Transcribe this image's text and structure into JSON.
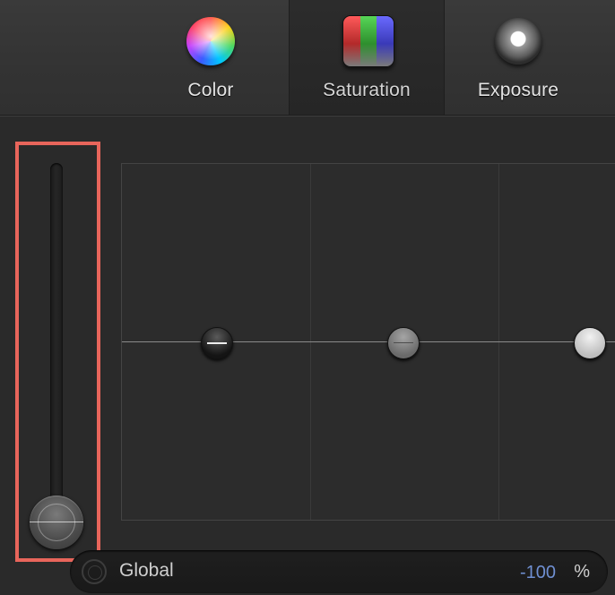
{
  "tabs": [
    {
      "label": "Color",
      "icon": "color-wheel-icon"
    },
    {
      "label": "Saturation",
      "icon": "saturation-bars-icon",
      "selected": true
    },
    {
      "label": "Exposure",
      "icon": "exposure-icon"
    }
  ],
  "global_slider": {
    "level_fraction": 0.0
  },
  "curve": {
    "points": [
      {
        "name": "shadows",
        "level_fraction": 0.5
      },
      {
        "name": "midtones",
        "level_fraction": 0.5
      },
      {
        "name": "highlights",
        "level_fraction": 0.5
      }
    ]
  },
  "status": {
    "label": "Global",
    "value": "-100",
    "unit": "%"
  },
  "colors": {
    "highlight_border": "#e8655b",
    "value_text": "#6f8fd1"
  }
}
